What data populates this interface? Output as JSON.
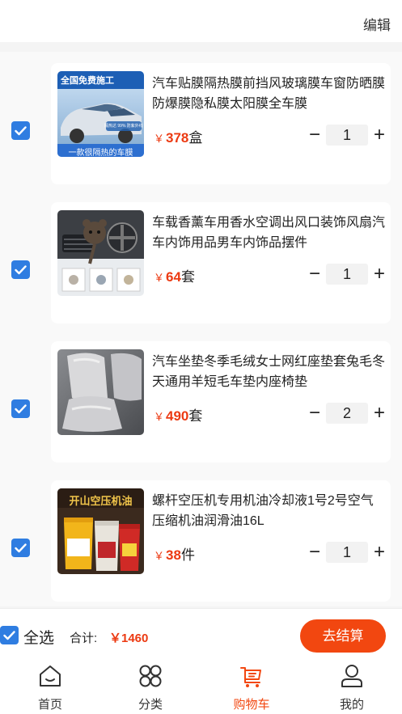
{
  "header": {
    "edit_label": "编辑"
  },
  "cart": {
    "items": [
      {
        "title": "汽车贴膜隔热膜前挡风玻璃膜车窗防晒膜防爆膜隐私膜太阳膜全车膜",
        "currency": "￥",
        "price": "378",
        "unit": "盒",
        "quantity": "1",
        "checked": true,
        "image_text": {
          "banner": "全国免费施工",
          "tag": "隔热达 99% 防紫外线",
          "caption": "一款很隔热的车膜"
        }
      },
      {
        "title": "车载香薰车用香水空调出风口装饰风扇汽车内饰用品男车内饰品摆件",
        "currency": "￥",
        "price": "64",
        "unit": "套",
        "quantity": "1",
        "checked": true
      },
      {
        "title": "汽车坐垫冬季毛绒女士网红座垫套兔毛冬天通用羊短毛车垫内座椅垫",
        "currency": "￥",
        "price": "490",
        "unit": "套",
        "quantity": "2",
        "checked": true
      },
      {
        "title": "螺杆空压机专用机油冷却液1号2号空气压缩机油润滑油16L",
        "currency": "￥",
        "price": "38",
        "unit": "件",
        "quantity": "1",
        "checked": true,
        "image_text": {
          "banner": "开山空压机油"
        }
      }
    ]
  },
  "footer": {
    "select_all_label": "全选",
    "total_label": "合计:",
    "total_value": "￥1460",
    "checkout_label": "去结算"
  },
  "tabbar": {
    "tabs": [
      {
        "label": "首页",
        "icon": "home-icon"
      },
      {
        "label": "分类",
        "icon": "category-icon"
      },
      {
        "label": "购物车",
        "icon": "cart-icon",
        "active": true
      },
      {
        "label": "我的",
        "icon": "user-icon"
      }
    ]
  },
  "colors": {
    "accent": "#f24710",
    "price": "#ec3a12",
    "checkbox": "#2f7de1"
  }
}
